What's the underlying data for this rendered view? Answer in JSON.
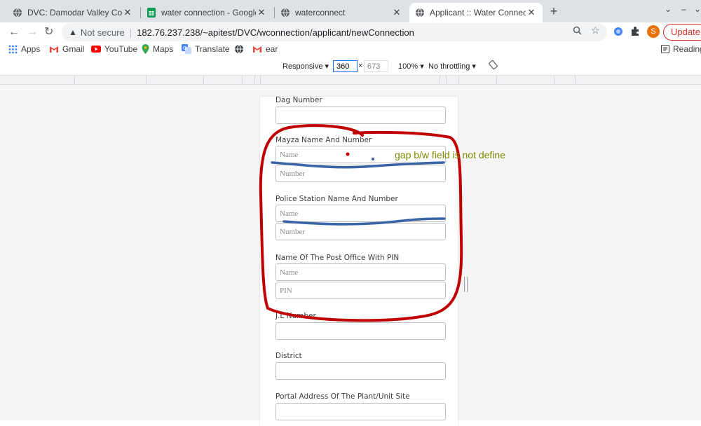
{
  "tabs": [
    {
      "title": "DVC: Damodar Valley Corpora",
      "icon": "globe-icon",
      "active": false
    },
    {
      "title": "water connection - Google Sh",
      "icon": "sheets-icon",
      "active": false
    },
    {
      "title": "waterconnect",
      "icon": "globe-icon",
      "active": false
    },
    {
      "title": "Applicant :: Water Connection",
      "icon": "globe-icon",
      "active": true
    }
  ],
  "toolbar": {
    "security_label": "Not secure",
    "url": "182.76.237.238/~apitest/DVC/wconnection/applicant/newConnection",
    "profile_initial": "S",
    "update_label": "Update"
  },
  "bookmarks": [
    {
      "label": "Apps",
      "icon": "apps-grid-icon"
    },
    {
      "label": "Gmail",
      "icon": "gmail-icon"
    },
    {
      "label": "YouTube",
      "icon": "youtube-icon"
    },
    {
      "label": "Maps",
      "icon": "maps-pin-icon"
    },
    {
      "label": "Translate",
      "icon": "translate-icon"
    },
    {
      "label": "",
      "icon": "globe-icon"
    },
    {
      "label": "ear",
      "icon": "gmail-icon"
    }
  ],
  "reading_list_label": "Reading",
  "device_toolbar": {
    "mode": "Responsive",
    "width": "360",
    "height": "673",
    "zoom": "100%",
    "throttling": "No throttling"
  },
  "form": {
    "dag_label": "Dag Number",
    "mayza_label": "Mayza Name And Number",
    "mayza_name_placeholder": "Name",
    "mayza_number_placeholder": "Number",
    "police_label": "Police Station Name And Number",
    "police_name_placeholder": "Name",
    "police_number_placeholder": "Number",
    "post_label": "Name Of The Post Office With PIN",
    "post_name_placeholder": "Name",
    "post_pin_placeholder": "PIN",
    "jl_label": "J.L Number",
    "district_label": "District",
    "portal_label": "Portal Address Of The Plant/Unit Site"
  },
  "annotation": {
    "text": "gap b/w field is not define",
    "circle_color": "#c00000",
    "underline_color": "#3a64a8",
    "text_color": "#7d8a00"
  }
}
